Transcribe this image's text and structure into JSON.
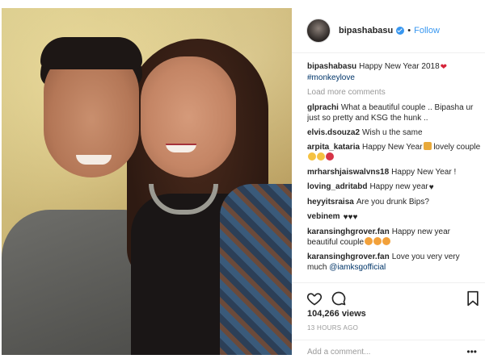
{
  "header": {
    "username": "bipashabasu",
    "separator": "•",
    "follow_label": "Follow"
  },
  "caption": {
    "username": "bipashabasu",
    "text": "Happy New Year 2018",
    "hashtag": "#monkeylove"
  },
  "load_more_label": "Load more comments",
  "comments": [
    {
      "user": "glprachi",
      "text": "What a beautiful couple .. Bipasha ur just so pretty and KSG the hunk .."
    },
    {
      "user": "elvis.dsouza2",
      "text": "Wish u the same"
    },
    {
      "user": "arpita_kataria",
      "text": "Happy New Year",
      "text2": " lovely couple"
    },
    {
      "user": "mrharshjaiswalvns18",
      "text": "Happy New Year !"
    },
    {
      "user": "loving_adritabd",
      "text": "Happy new year"
    },
    {
      "user": "heyyitsraisa",
      "text": "Are you drunk Bips?"
    },
    {
      "user": "vebinem",
      "text": ""
    },
    {
      "user": "karansinghgrover.fan",
      "text": "Happy new year beautiful couple"
    },
    {
      "user": "karansinghgrover.fan",
      "text": "Love you very very much",
      "mention": "@iamksgofficial"
    }
  ],
  "hearts_vebinem": "♥♥♥",
  "views": "104,266 views",
  "timestamp": "13 HOURS AGO",
  "add_comment_placeholder": "Add a comment...",
  "more_label": "•••",
  "icons": {
    "like": "heart-outline-icon",
    "comment": "speech-bubble-icon",
    "save": "bookmark-icon",
    "verified": "verified-badge-icon"
  },
  "colors": {
    "accent": "#3897f0",
    "text": "#262626",
    "muted": "#999999",
    "heart": "#d6243a"
  }
}
